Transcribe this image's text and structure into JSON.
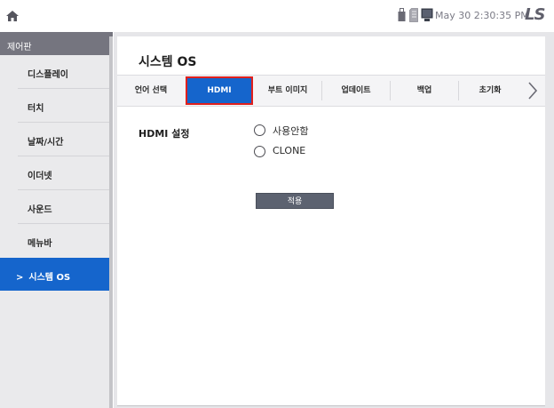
{
  "status_bar": {
    "datetime": "May 30 2:30:35 PM",
    "logo": "LS",
    "icons": [
      "home-icon",
      "usb-icon",
      "sd-card-icon",
      "monitor-icon"
    ]
  },
  "sidebar": {
    "header": "제어판",
    "items": [
      {
        "label": "디스플레이"
      },
      {
        "label": "터치"
      },
      {
        "label": "날짜/시간"
      },
      {
        "label": "이더넷"
      },
      {
        "label": "사운드"
      },
      {
        "label": "메뉴바"
      },
      {
        "label": "시스템 OS"
      }
    ],
    "active_index": 6,
    "active_marker": ">"
  },
  "main": {
    "title": "시스템 OS",
    "tabs": [
      {
        "label": "언어 선택"
      },
      {
        "label": "HDMI"
      },
      {
        "label": "부트 이미지"
      },
      {
        "label": "업데이트"
      },
      {
        "label": "백업"
      },
      {
        "label": "초기화"
      }
    ],
    "active_tab": "HDMI",
    "hdmi": {
      "label": "HDMI 설정",
      "options": [
        {
          "label": "사용안함"
        },
        {
          "label": "CLONE"
        }
      ],
      "apply": "적용"
    }
  },
  "colors": {
    "accent": "#1565cc",
    "highlight_border": "#e0201d",
    "sidebar_header": "#75757f",
    "button": "#5c6270"
  }
}
